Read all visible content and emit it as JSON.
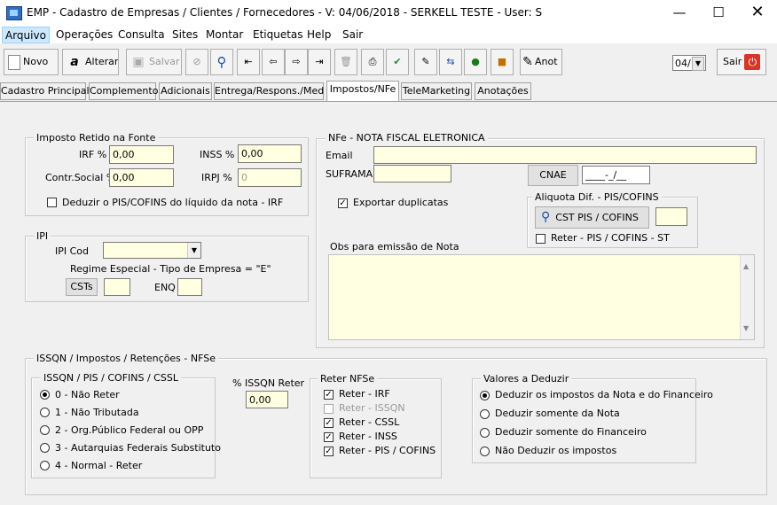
{
  "window": {
    "title": "EMP - Cadastro de Empresas / Clientes / Fornecedores - V: 04/06/2018 - SERKELL TESTE - User: S"
  },
  "menu": [
    "Arquivo",
    "Operações",
    "Consulta",
    "Sites",
    "Montar",
    "Etiquetas",
    "Help",
    "Sair"
  ],
  "toolbar": {
    "novo": "Novo",
    "alterar": "Alterar",
    "salvar": "Salvar",
    "anot": "Anot",
    "combo_value": "04/",
    "sair": "Sair"
  },
  "tabs": [
    "Cadastro Principal",
    "Complemento",
    "Adicionais",
    "Entrega/Respons./Med",
    "Impostos/NFe",
    "TeleMarketing",
    "Anotações"
  ],
  "imposto_retido": {
    "title": "Imposto Retido na Fonte",
    "irf_label": "IRF %",
    "irf_value": "0,00",
    "inss_label": "INSS %",
    "inss_value": "0,00",
    "contr_label": "Contr.Social %",
    "contr_value": "0,00",
    "irpj_label": "IRPJ %",
    "irpj_value": "0",
    "deduzir_label": "Deduzir o PIS/COFINS do líquido da nota - IRF"
  },
  "ipi": {
    "title": "IPI",
    "cod_label": "IPI Cod",
    "regime_label": "Regime Especial - Tipo de Empresa = \"E\"",
    "csts_button": "CSTs",
    "enq_label": "ENQ"
  },
  "nfe": {
    "title": "NFe - NOTA FISCAL ELETRONICA",
    "email_label": "Email",
    "suframa_label": "SUFRAMA",
    "cnae_button": "CNAE",
    "cnae_value": "____-_/__",
    "exportar_label": "Exportar duplicatas",
    "aliquota_title": "Aliquota Dif. - PIS/COFINS",
    "cst_button": "CST PIS / COFINS",
    "reter_st_label": "Reter - PIS / COFINS - ST",
    "obs_label": "Obs para emissão de Nota"
  },
  "issqn": {
    "title": "ISSQN / Impostos / Retenções  - NFSe",
    "group_title": "ISSQN / PIS / COFINS / CSSL",
    "options": [
      "0 - Não Reter",
      "1 - Não Tributada",
      "2 - Org.Público Federal ou OPP",
      "3 - Autarquias Federais Substituto",
      "4 - Normal - Reter"
    ],
    "pct_label": "% ISSQN Reter",
    "pct_value": "0,00",
    "reter_title": "Reter NFSe",
    "reter_items": [
      "Reter - IRF",
      "Reter - ISSQN",
      "Reter - CSSL",
      "Reter - INSS",
      "Reter - PIS / COFINS"
    ],
    "valores_title": "Valores a Deduzir",
    "valores_options": [
      "Deduzir os impostos da Nota e do Financeiro",
      "Deduzir somente da Nota",
      "Deduzir somente do Financeiro",
      "Não Deduzir os impostos"
    ]
  }
}
